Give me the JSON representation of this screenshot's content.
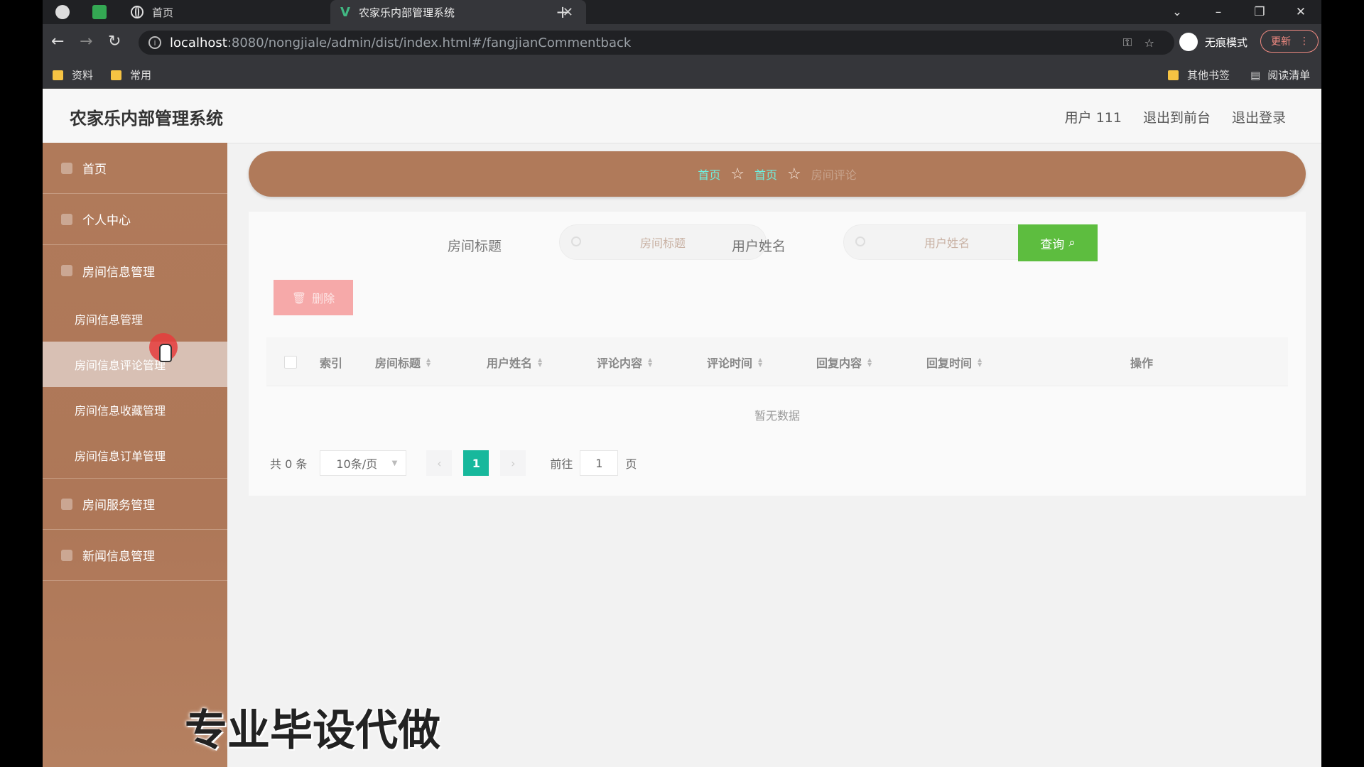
{
  "browser": {
    "tabs": [
      {
        "title": "首页"
      },
      {
        "title": "农家乐内部管理系统"
      }
    ],
    "url_host": "localhost",
    "url_path": ":8080/nongjiale/admin/dist/index.html#/fangjianCommentback",
    "incognito_label": "无痕模式",
    "update_label": "更新",
    "bookmarks": [
      "资料",
      "常用"
    ],
    "bookmarks_right": [
      "其他书签",
      "阅读清单"
    ]
  },
  "header": {
    "title": "农家乐内部管理系统",
    "user": "用户 111",
    "back_front": "退出到前台",
    "logout": "退出登录"
  },
  "sidebar": {
    "items": [
      {
        "label": "首页"
      },
      {
        "label": "个人中心"
      },
      {
        "label": "房间信息管理"
      }
    ],
    "sub_items": [
      {
        "label": "房间信息管理"
      },
      {
        "label": "房间信息评论管理"
      },
      {
        "label": "房间信息收藏管理"
      },
      {
        "label": "房间信息订单管理"
      }
    ],
    "items_after": [
      {
        "label": "房间服务管理"
      },
      {
        "label": "新闻信息管理"
      }
    ]
  },
  "breadcrumb": [
    "首页",
    "首页",
    "房间评论"
  ],
  "search": {
    "title_label": "房间标题",
    "title_placeholder": "房间标题",
    "user_label": "用户姓名",
    "user_placeholder": "用户姓名",
    "query_label": "查询"
  },
  "actions": {
    "delete_label": "删除"
  },
  "table": {
    "columns": [
      "索引",
      "房间标题",
      "用户姓名",
      "评论内容",
      "评论时间",
      "回复内容",
      "回复时间",
      "操作"
    ],
    "empty_text": "暂无数据"
  },
  "pagination": {
    "total": "共 0 条",
    "page_size": "10条/页",
    "current_page": "1",
    "goto_prefix": "前往",
    "goto_value": "1",
    "goto_suffix": "页"
  },
  "watermark": "专业毕设代做"
}
